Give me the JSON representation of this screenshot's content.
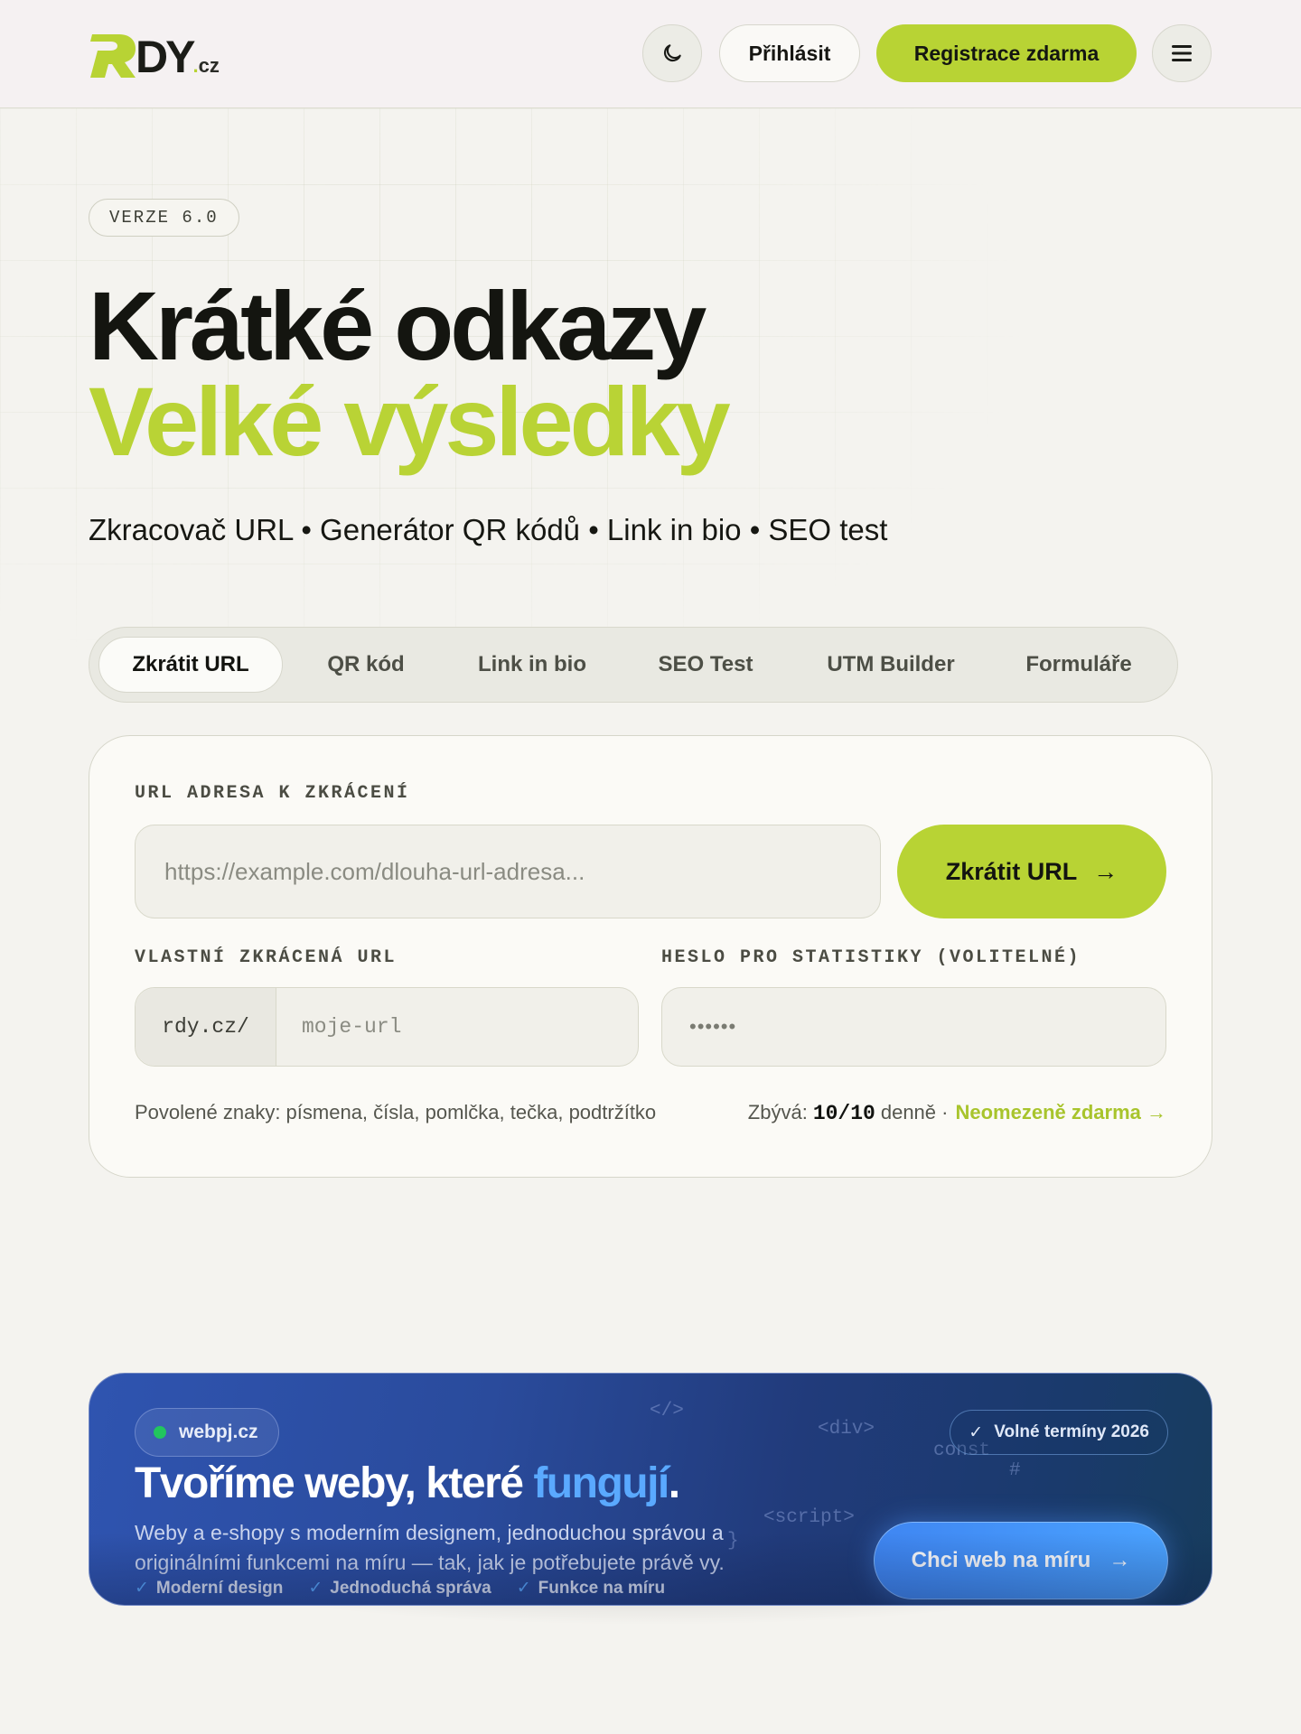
{
  "colors": {
    "accent": "#b8d334",
    "promo_accent": "#5aa9ff",
    "background": "#f4f3ef"
  },
  "header": {
    "logo": {
      "mark": "R",
      "name": "DY",
      "dot": ".",
      "tld": "cz"
    },
    "theme_toggle_icon": "moon-icon",
    "login_label": "Přihlásit",
    "register_label": "Registrace zdarma",
    "menu_icon": "hamburger-icon"
  },
  "hero": {
    "version_badge": "VERZE 6.0",
    "title_line1": "Krátké odkazy",
    "title_line2": "Velké výsledky",
    "subtitle": "Zkracovač URL • Generátor QR kódů • Link in bio • SEO test"
  },
  "tabs": [
    {
      "label": "Zkrátit URL",
      "active": true
    },
    {
      "label": "QR kód",
      "active": false
    },
    {
      "label": "Link in bio",
      "active": false
    },
    {
      "label": "SEO Test",
      "active": false
    },
    {
      "label": "UTM Builder",
      "active": false
    },
    {
      "label": "Formuláře",
      "active": false
    }
  ],
  "form": {
    "url_label": "URL ADRESA K ZKRÁCENÍ",
    "url_placeholder": "https://example.com/dlouha-url-adresa...",
    "submit_label": "Zkrátit URL",
    "submit_arrow": "→",
    "custom_label": "VLASTNÍ ZKRÁCENÁ URL",
    "custom_prefix": "rdy.cz/",
    "custom_placeholder": "moje-url",
    "password_label": "HESLO PRO STATISTIKY (VOLITELNÉ)",
    "password_placeholder": "••••••",
    "hint": "Povolené znaky: písmena, čísla, pomlčka, tečka, podtržítko",
    "quota_prefix": "Zbývá:",
    "quota_value": "10/10",
    "quota_suffix": "denně ·",
    "upsell_label": "Neomezeně zdarma →"
  },
  "promo": {
    "chip_label": "webpj.cz",
    "title_main": "Tvoříme weby, které ",
    "title_accent": "fungují",
    "title_end": ".",
    "description": "Weby a e-shopy s moderním designem, jednoduchou správou a originálními funkcemi na míru — tak, jak je potřebujete právě vy.",
    "features": [
      "Moderní design",
      "Jednoduchá správa",
      "Funkce na míru"
    ],
    "terms_badge": "Volné termíny 2026",
    "cta_label": "Chci web na míru",
    "cta_arrow": "→",
    "code_decorations": [
      "</>",
      "<div>",
      "const",
      "#",
      "<script>",
      "}"
    ]
  }
}
